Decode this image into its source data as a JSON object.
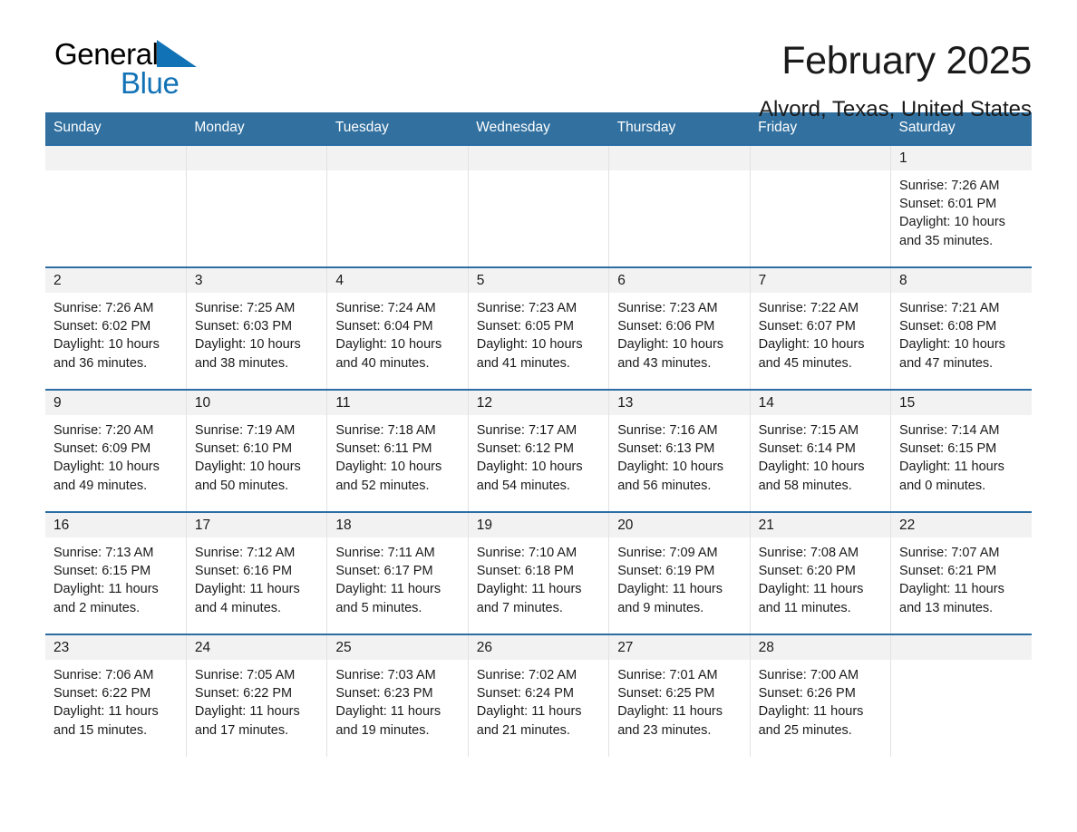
{
  "brand": {
    "name_part1": "General",
    "name_part2": "Blue",
    "triangle_color": "#1272b6",
    "text_color": "#000000"
  },
  "header": {
    "title": "February 2025",
    "subtitle": "Alvord, Texas, United States"
  },
  "colors": {
    "header_row_background": "#31709f",
    "header_row_text": "#ffffff",
    "week_row_border": "#2c6ea3",
    "daynum_band_background": "#f2f2f2",
    "page_background": "#ffffff",
    "body_text": "#1a1a1a"
  },
  "weekdays": [
    "Sunday",
    "Monday",
    "Tuesday",
    "Wednesday",
    "Thursday",
    "Friday",
    "Saturday"
  ],
  "labels": {
    "sunrise_prefix": "Sunrise:",
    "sunset_prefix": "Sunset:",
    "daylight_prefix": "Daylight:"
  },
  "weeks": [
    [
      {
        "day": "",
        "empty": true
      },
      {
        "day": "",
        "empty": true
      },
      {
        "day": "",
        "empty": true
      },
      {
        "day": "",
        "empty": true
      },
      {
        "day": "",
        "empty": true
      },
      {
        "day": "",
        "empty": true
      },
      {
        "day": "1",
        "sunrise": "Sunrise: 7:26 AM",
        "sunset": "Sunset: 6:01 PM",
        "daylight": "Daylight: 10 hours and 35 minutes."
      }
    ],
    [
      {
        "day": "2",
        "sunrise": "Sunrise: 7:26 AM",
        "sunset": "Sunset: 6:02 PM",
        "daylight": "Daylight: 10 hours and 36 minutes."
      },
      {
        "day": "3",
        "sunrise": "Sunrise: 7:25 AM",
        "sunset": "Sunset: 6:03 PM",
        "daylight": "Daylight: 10 hours and 38 minutes."
      },
      {
        "day": "4",
        "sunrise": "Sunrise: 7:24 AM",
        "sunset": "Sunset: 6:04 PM",
        "daylight": "Daylight: 10 hours and 40 minutes."
      },
      {
        "day": "5",
        "sunrise": "Sunrise: 7:23 AM",
        "sunset": "Sunset: 6:05 PM",
        "daylight": "Daylight: 10 hours and 41 minutes."
      },
      {
        "day": "6",
        "sunrise": "Sunrise: 7:23 AM",
        "sunset": "Sunset: 6:06 PM",
        "daylight": "Daylight: 10 hours and 43 minutes."
      },
      {
        "day": "7",
        "sunrise": "Sunrise: 7:22 AM",
        "sunset": "Sunset: 6:07 PM",
        "daylight": "Daylight: 10 hours and 45 minutes."
      },
      {
        "day": "8",
        "sunrise": "Sunrise: 7:21 AM",
        "sunset": "Sunset: 6:08 PM",
        "daylight": "Daylight: 10 hours and 47 minutes."
      }
    ],
    [
      {
        "day": "9",
        "sunrise": "Sunrise: 7:20 AM",
        "sunset": "Sunset: 6:09 PM",
        "daylight": "Daylight: 10 hours and 49 minutes."
      },
      {
        "day": "10",
        "sunrise": "Sunrise: 7:19 AM",
        "sunset": "Sunset: 6:10 PM",
        "daylight": "Daylight: 10 hours and 50 minutes."
      },
      {
        "day": "11",
        "sunrise": "Sunrise: 7:18 AM",
        "sunset": "Sunset: 6:11 PM",
        "daylight": "Daylight: 10 hours and 52 minutes."
      },
      {
        "day": "12",
        "sunrise": "Sunrise: 7:17 AM",
        "sunset": "Sunset: 6:12 PM",
        "daylight": "Daylight: 10 hours and 54 minutes."
      },
      {
        "day": "13",
        "sunrise": "Sunrise: 7:16 AM",
        "sunset": "Sunset: 6:13 PM",
        "daylight": "Daylight: 10 hours and 56 minutes."
      },
      {
        "day": "14",
        "sunrise": "Sunrise: 7:15 AM",
        "sunset": "Sunset: 6:14 PM",
        "daylight": "Daylight: 10 hours and 58 minutes."
      },
      {
        "day": "15",
        "sunrise": "Sunrise: 7:14 AM",
        "sunset": "Sunset: 6:15 PM",
        "daylight": "Daylight: 11 hours and 0 minutes."
      }
    ],
    [
      {
        "day": "16",
        "sunrise": "Sunrise: 7:13 AM",
        "sunset": "Sunset: 6:15 PM",
        "daylight": "Daylight: 11 hours and 2 minutes."
      },
      {
        "day": "17",
        "sunrise": "Sunrise: 7:12 AM",
        "sunset": "Sunset: 6:16 PM",
        "daylight": "Daylight: 11 hours and 4 minutes."
      },
      {
        "day": "18",
        "sunrise": "Sunrise: 7:11 AM",
        "sunset": "Sunset: 6:17 PM",
        "daylight": "Daylight: 11 hours and 5 minutes."
      },
      {
        "day": "19",
        "sunrise": "Sunrise: 7:10 AM",
        "sunset": "Sunset: 6:18 PM",
        "daylight": "Daylight: 11 hours and 7 minutes."
      },
      {
        "day": "20",
        "sunrise": "Sunrise: 7:09 AM",
        "sunset": "Sunset: 6:19 PM",
        "daylight": "Daylight: 11 hours and 9 minutes."
      },
      {
        "day": "21",
        "sunrise": "Sunrise: 7:08 AM",
        "sunset": "Sunset: 6:20 PM",
        "daylight": "Daylight: 11 hours and 11 minutes."
      },
      {
        "day": "22",
        "sunrise": "Sunrise: 7:07 AM",
        "sunset": "Sunset: 6:21 PM",
        "daylight": "Daylight: 11 hours and 13 minutes."
      }
    ],
    [
      {
        "day": "23",
        "sunrise": "Sunrise: 7:06 AM",
        "sunset": "Sunset: 6:22 PM",
        "daylight": "Daylight: 11 hours and 15 minutes."
      },
      {
        "day": "24",
        "sunrise": "Sunrise: 7:05 AM",
        "sunset": "Sunset: 6:22 PM",
        "daylight": "Daylight: 11 hours and 17 minutes."
      },
      {
        "day": "25",
        "sunrise": "Sunrise: 7:03 AM",
        "sunset": "Sunset: 6:23 PM",
        "daylight": "Daylight: 11 hours and 19 minutes."
      },
      {
        "day": "26",
        "sunrise": "Sunrise: 7:02 AM",
        "sunset": "Sunset: 6:24 PM",
        "daylight": "Daylight: 11 hours and 21 minutes."
      },
      {
        "day": "27",
        "sunrise": "Sunrise: 7:01 AM",
        "sunset": "Sunset: 6:25 PM",
        "daylight": "Daylight: 11 hours and 23 minutes."
      },
      {
        "day": "28",
        "sunrise": "Sunrise: 7:00 AM",
        "sunset": "Sunset: 6:26 PM",
        "daylight": "Daylight: 11 hours and 25 minutes."
      },
      {
        "day": "",
        "empty": true
      }
    ]
  ]
}
